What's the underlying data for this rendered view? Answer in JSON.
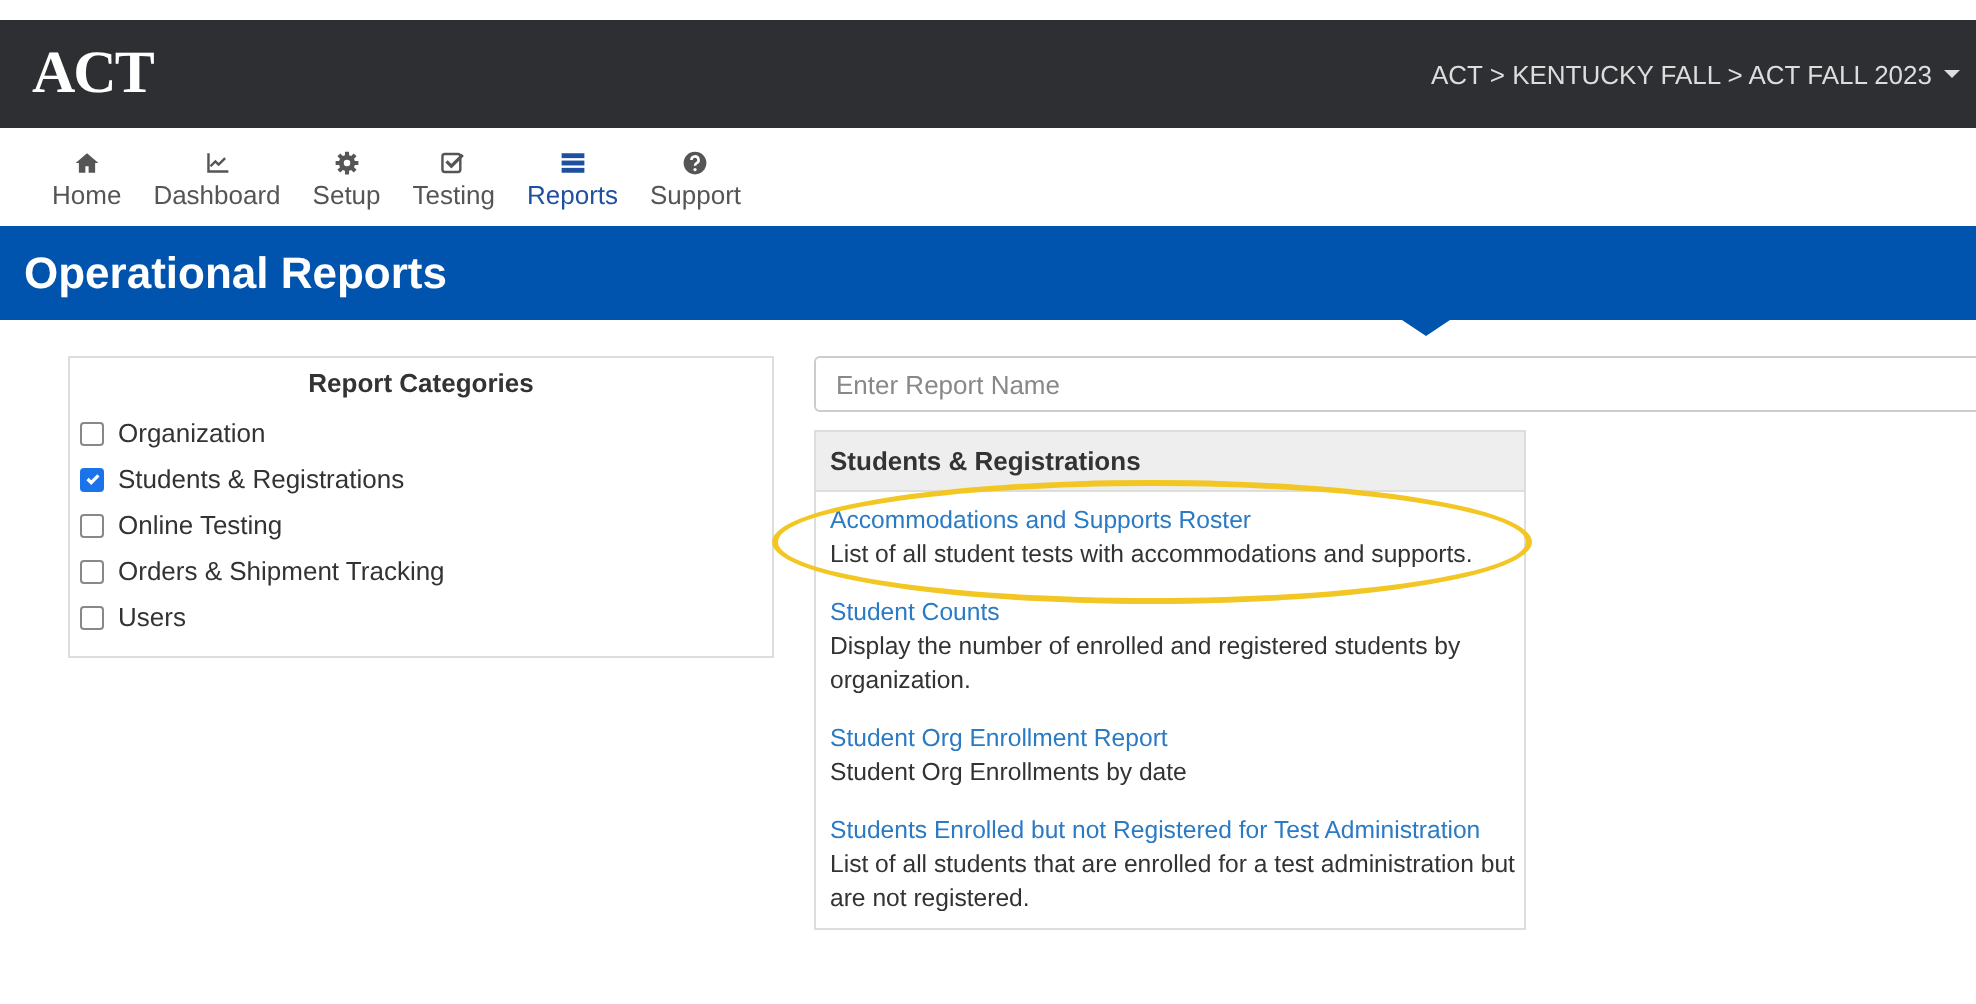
{
  "header": {
    "logo": "ACT",
    "breadcrumb": "ACT > KENTUCKY FALL > ACT FALL 2023"
  },
  "nav": [
    {
      "kind": "home",
      "label": "Home",
      "selected": false
    },
    {
      "kind": "dashboard",
      "label": "Dashboard",
      "selected": false
    },
    {
      "kind": "setup",
      "label": "Setup",
      "selected": false
    },
    {
      "kind": "testing",
      "label": "Testing",
      "selected": false
    },
    {
      "kind": "reports",
      "label": "Reports",
      "selected": true
    },
    {
      "kind": "support",
      "label": "Support",
      "selected": false
    }
  ],
  "page_title": "Operational Reports",
  "categories": {
    "title": "Report Categories",
    "items": [
      {
        "label": "Organization",
        "checked": false
      },
      {
        "label": "Students & Registrations",
        "checked": true
      },
      {
        "label": "Online Testing",
        "checked": false
      },
      {
        "label": "Orders & Shipment Tracking",
        "checked": false
      },
      {
        "label": "Users",
        "checked": false
      }
    ]
  },
  "search": {
    "placeholder": "Enter Report Name"
  },
  "reports": {
    "title": "Students & Registrations",
    "items": [
      {
        "name": "Accommodations and Supports Roster",
        "description": "List of all student tests with accommodations and supports.",
        "highlighted": true
      },
      {
        "name": "Student Counts",
        "description": "Display the number of enrolled and registered students by organization.",
        "highlighted": false
      },
      {
        "name": "Student Org Enrollment Report",
        "description": "Student Org Enrollments by date",
        "highlighted": false
      },
      {
        "name": "Students Enrolled but not Registered for Test Administration",
        "description": "List of all students that are enrolled for a test administration but are not registered.",
        "highlighted": false
      }
    ]
  }
}
